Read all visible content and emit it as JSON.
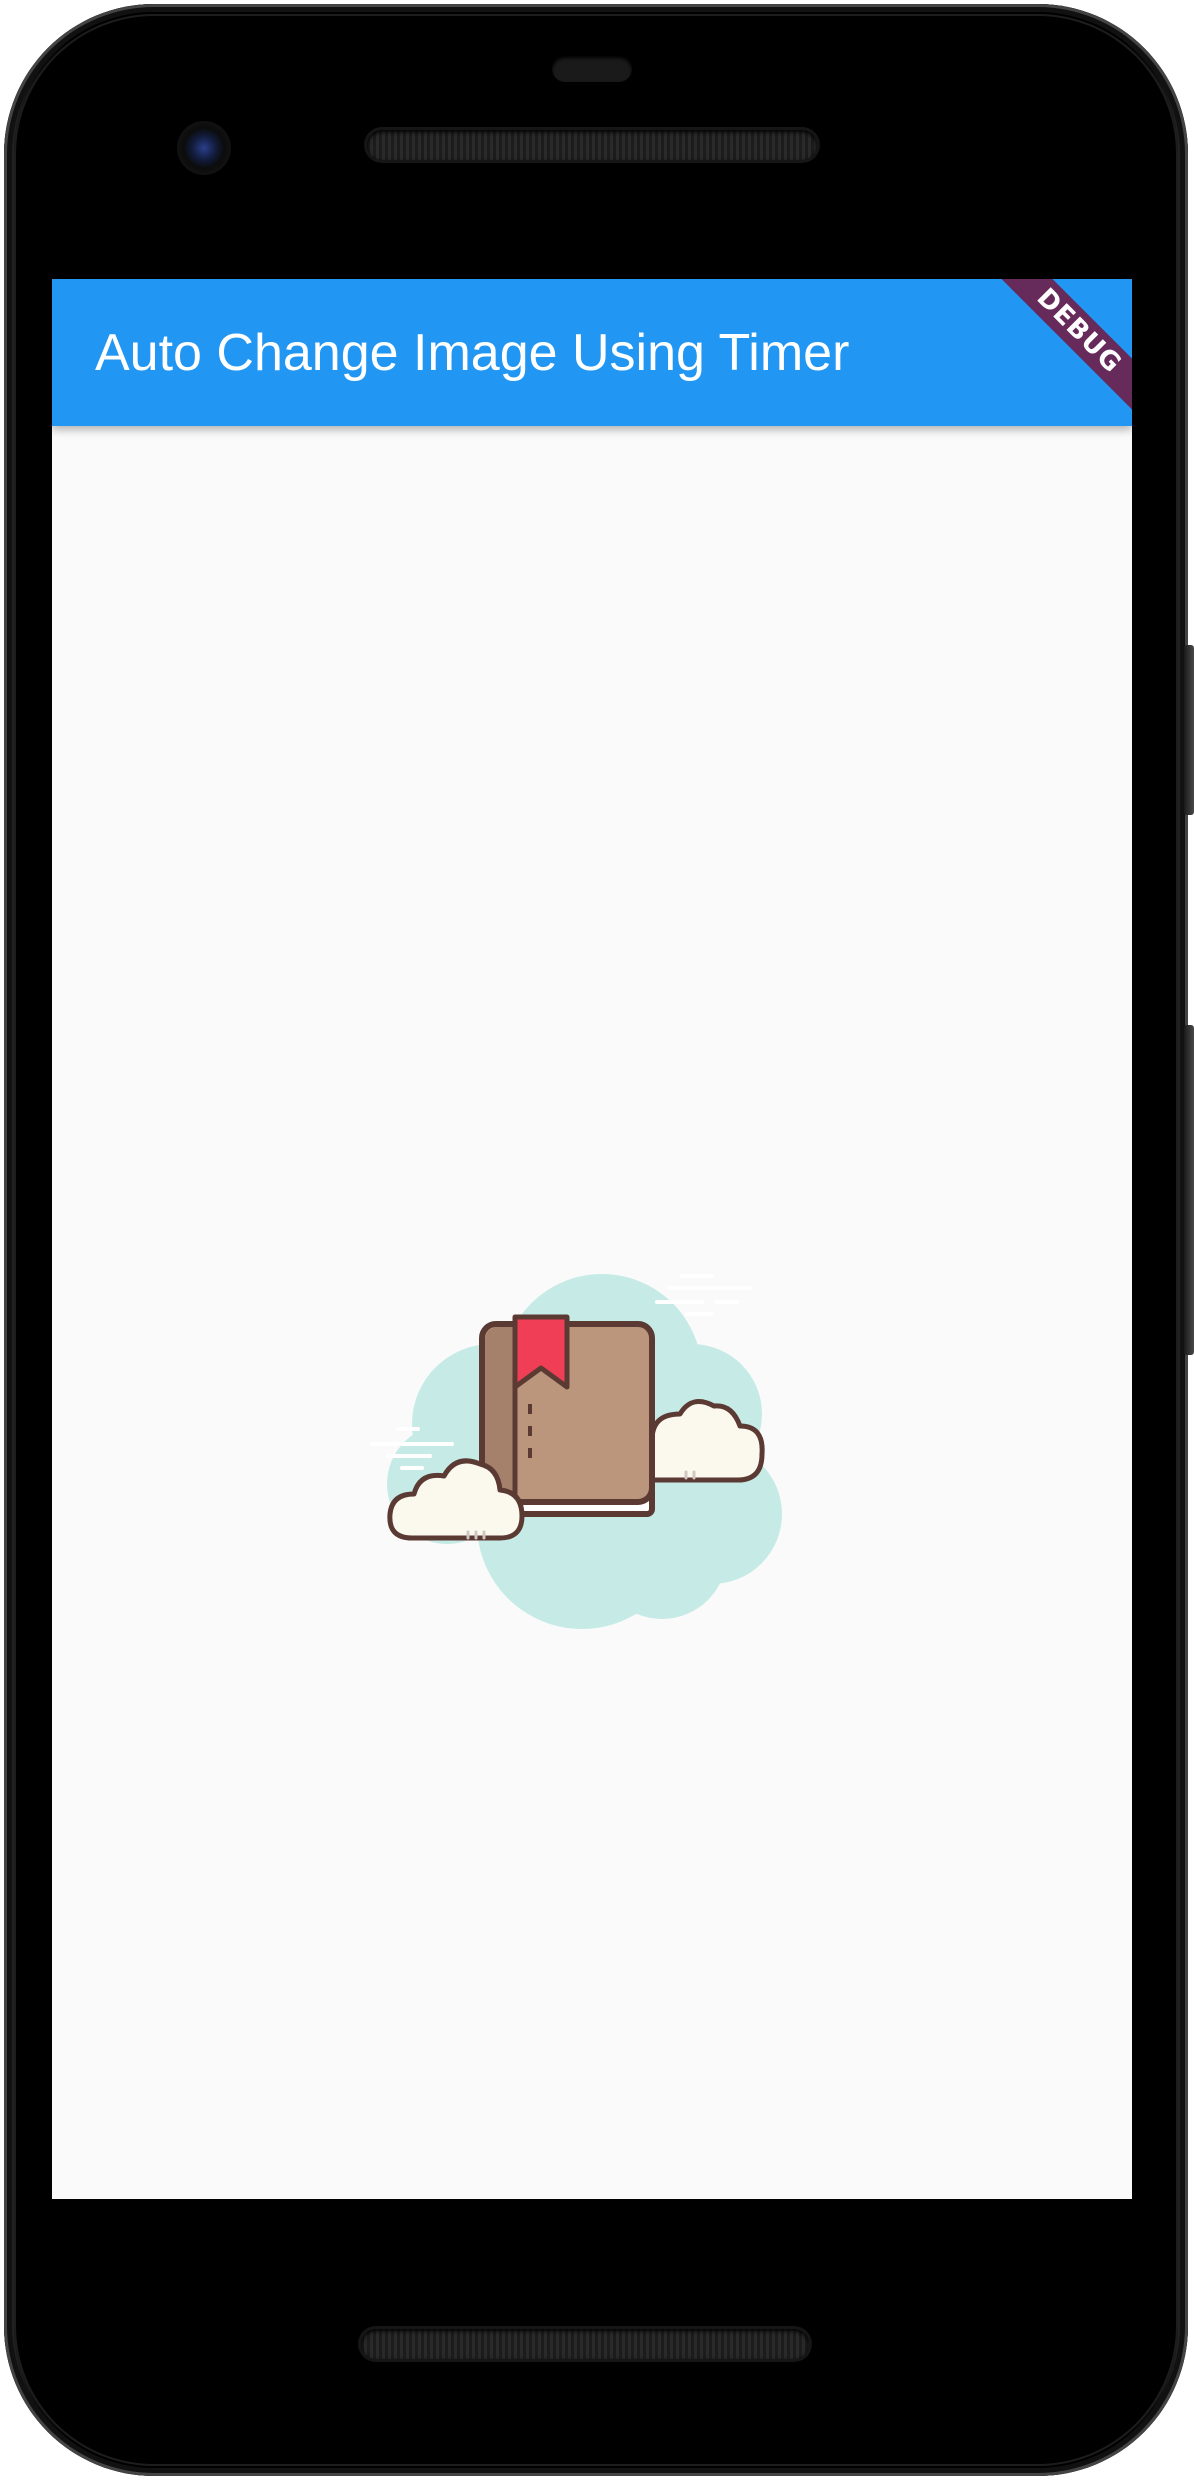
{
  "app_bar": {
    "title": "Auto Change Image Using Timer",
    "color": "#2196f3"
  },
  "debug_banner": {
    "label": "DEBUG",
    "color": "#810020"
  },
  "displayed_image": {
    "icon": "book-with-bookmark-among-clouds",
    "colors": {
      "cloud_background": "#c6ebe6",
      "book_cover": "#bb957c",
      "bookmark": "#ef3e55",
      "outline": "#5b3a34",
      "small_clouds": "#fbf8ee"
    }
  }
}
